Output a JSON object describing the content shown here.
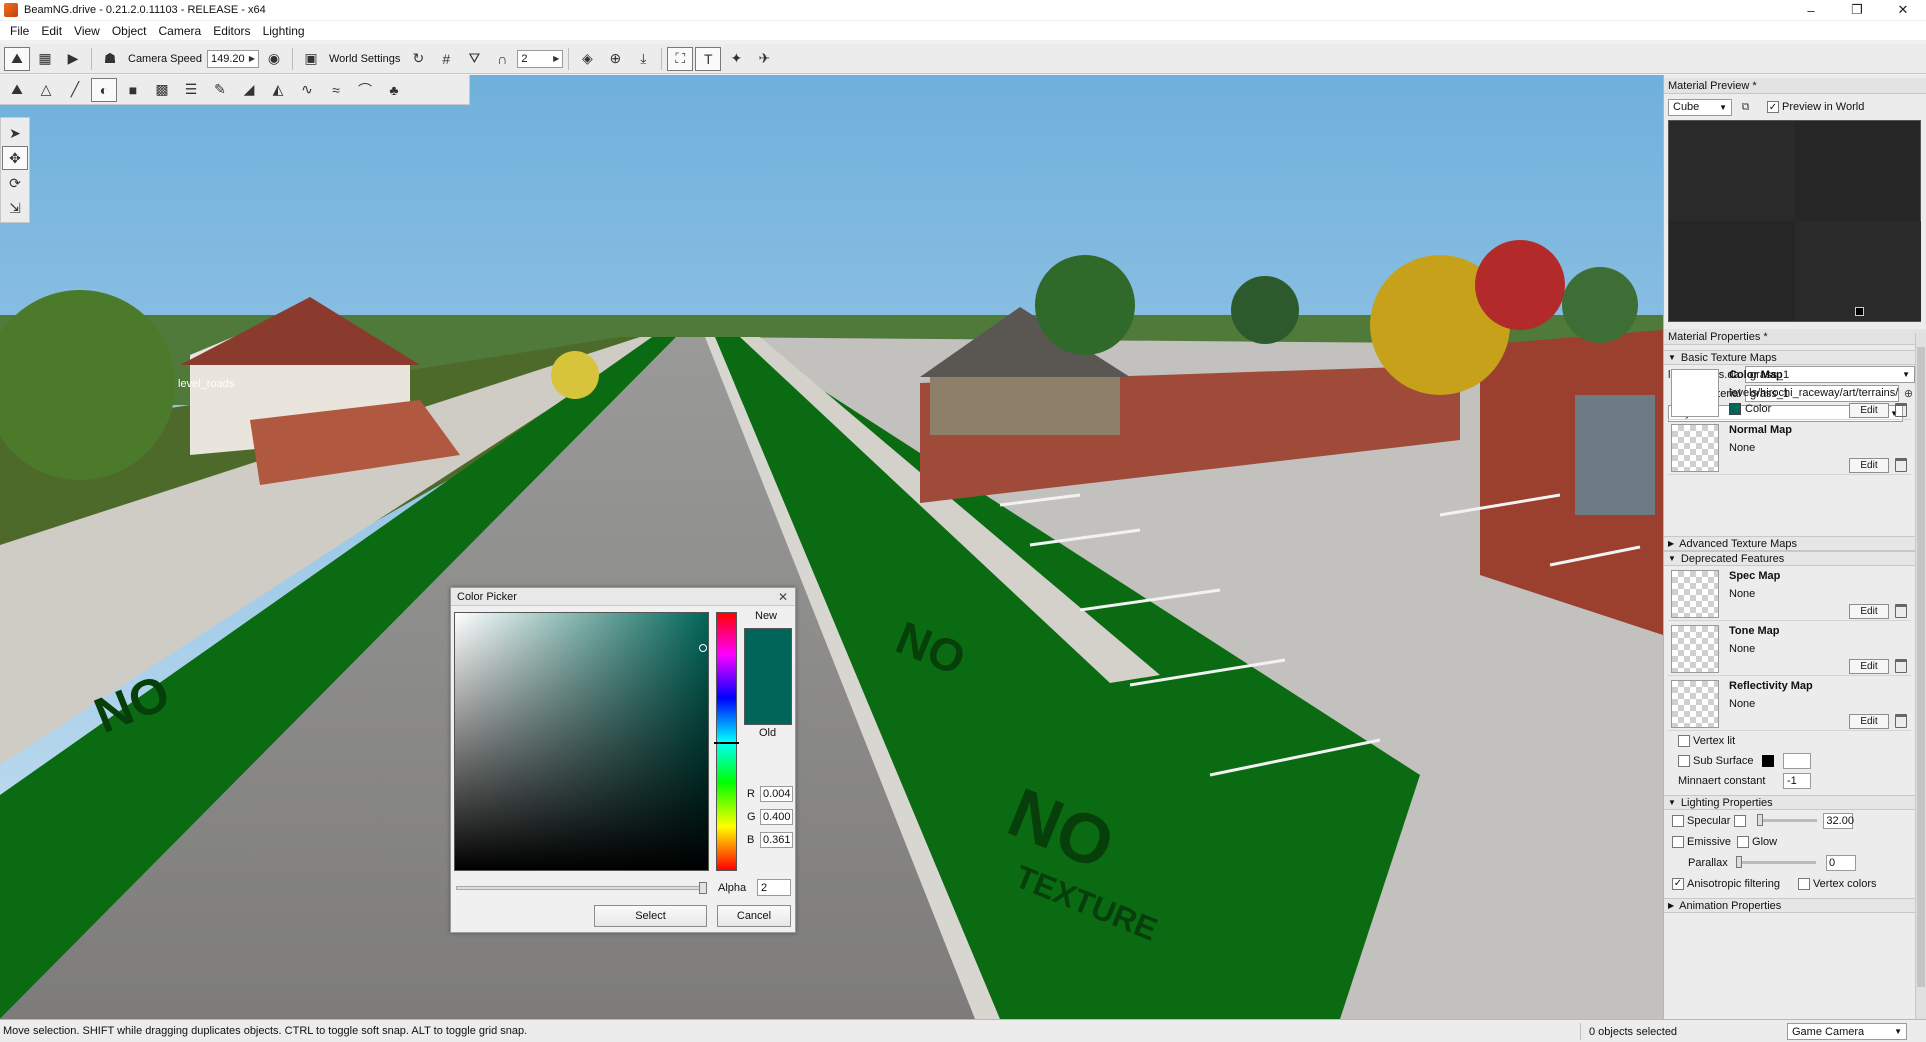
{
  "window": {
    "title": "BeamNG.drive - 0.21.2.0.11103 - RELEASE - x64",
    "minimize": "–",
    "maximize": "❐",
    "close": "✕"
  },
  "menu": [
    "File",
    "Edit",
    "View",
    "Object",
    "Camera",
    "Editors",
    "Lighting"
  ],
  "toolbar": {
    "camera_speed_label": "Camera Speed",
    "camera_speed_value": "149.20",
    "world_settings_label": "World Settings",
    "snap_value": "2"
  },
  "viewport": {
    "object_label": "level_roads",
    "no_texture_text": "NO",
    "no_texture_sub": "TEXTURE",
    "accent_color": "#0b6b12"
  },
  "color_picker": {
    "title": "Color Picker",
    "new_label": "New",
    "old_label": "Old",
    "r_label": "R",
    "r_value": "0.004",
    "g_label": "G",
    "g_value": "0.400",
    "b_label": "B",
    "b_value": "0.361",
    "alpha_label": "Alpha",
    "alpha_value": "2",
    "select_button": "Select",
    "cancel_button": "Cancel",
    "color": "#016659"
  },
  "material_preview": {
    "header": "Material Preview *",
    "shape_value": "Cube",
    "preview_in_world_label": "Preview in World"
  },
  "material_properties": {
    "header": "Material Properties *",
    "file_label": "level_roads.da",
    "file_value": "grass_1",
    "material_label": "Material",
    "material_value": "grass_1",
    "layer_value": "Layer 0",
    "sections": {
      "basic": "Basic Texture Maps",
      "advanced": "Advanced Texture Maps",
      "deprecated": "Deprecated Features",
      "lighting": "Lighting Properties",
      "animation": "Animation Properties"
    },
    "color_map": {
      "title": "Color Map",
      "path": "levels/hirochi_raceway/art/terrains/",
      "color_label": "Color",
      "edit": "Edit"
    },
    "normal_map": {
      "title": "Normal Map",
      "path": "None",
      "edit": "Edit"
    },
    "spec_map": {
      "title": "Spec Map",
      "path": "None",
      "edit": "Edit"
    },
    "tone_map": {
      "title": "Tone Map",
      "path": "None",
      "edit": "Edit"
    },
    "reflectivity_map": {
      "title": "Reflectivity Map",
      "path": "None",
      "edit": "Edit"
    },
    "vertex_lit_label": "Vertex lit",
    "sub_surface_label": "Sub Surface",
    "minnaert_label": "Minnaert constant",
    "minnaert_value": "-1",
    "specular_label": "Specular",
    "specular_value": "32.00",
    "emissive_label": "Emissive",
    "glow_label": "Glow",
    "parallax_label": "Parallax",
    "parallax_value": "0",
    "anisotropic_label": "Anisotropic filtering",
    "vertex_colors_label": "Vertex colors"
  },
  "statusbar": {
    "message": "Move selection.  SHIFT while dragging duplicates objects.  CTRL to toggle soft snap.  ALT to toggle grid snap.",
    "selection": "0 objects selected",
    "camera_mode": "Game Camera"
  }
}
